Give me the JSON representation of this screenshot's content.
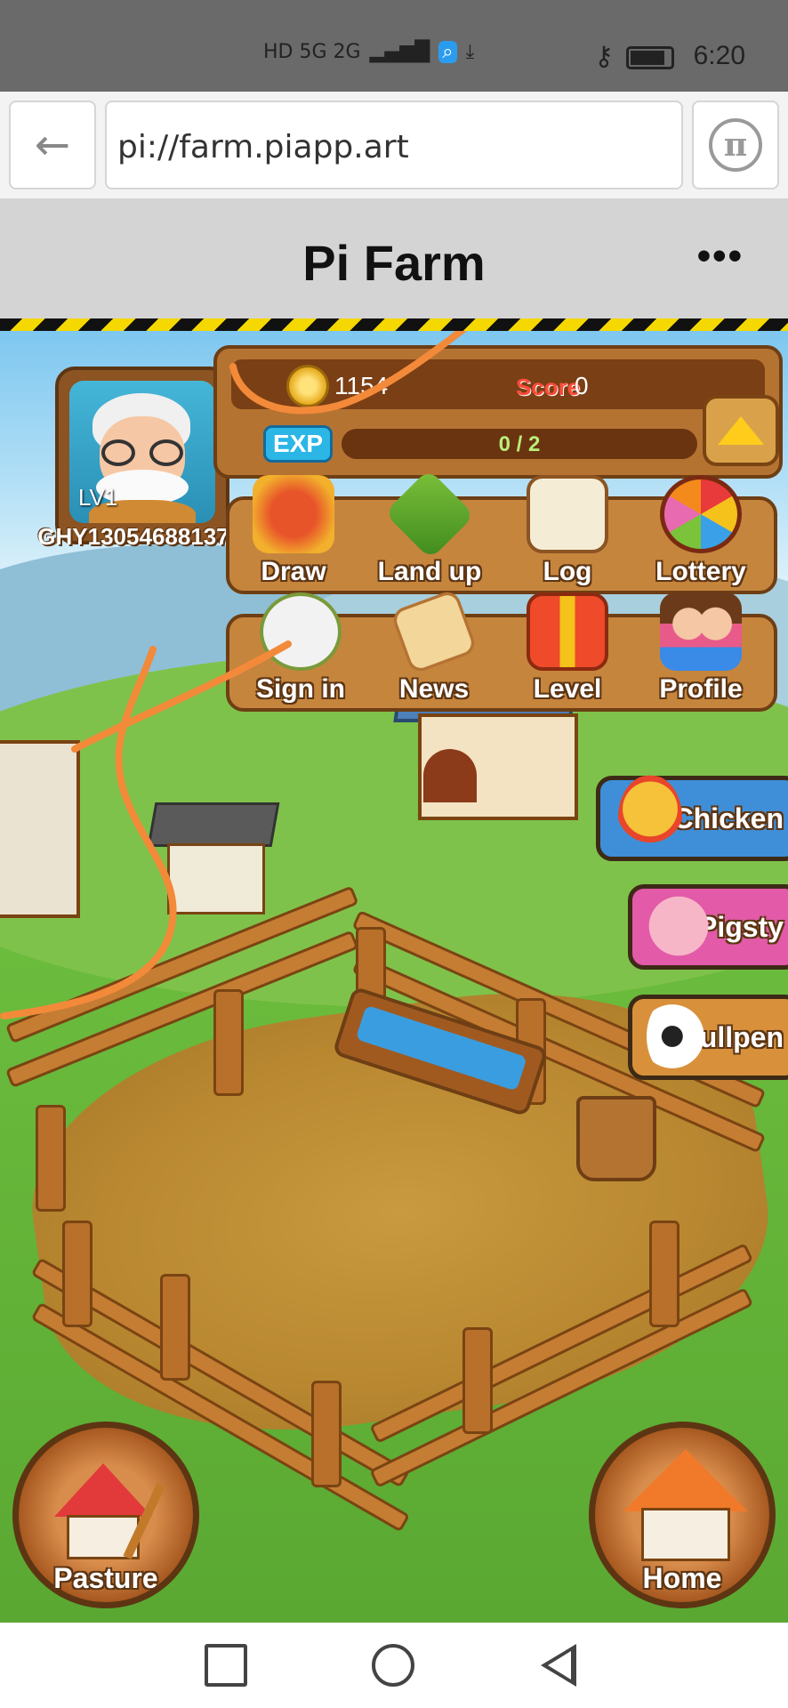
{
  "status_bar": {
    "network": "HD 5G 2G",
    "time": "6:20"
  },
  "browser": {
    "url": "pi://farm.piapp.art",
    "back_icon": "arrow-left-icon",
    "pi_icon": "pi-logo-icon"
  },
  "app": {
    "title": "Pi Farm",
    "more_label": "•••"
  },
  "player": {
    "level": "LV1",
    "name": "GHY13054688137",
    "coins": "1154",
    "score_label": "Score",
    "score": "0",
    "exp_label": "EXP",
    "exp": "0 / 2",
    "exp_fraction": 0
  },
  "menu": {
    "row1": [
      {
        "label": "Draw",
        "icon": "paint-bucket-icon"
      },
      {
        "label": "Land up",
        "icon": "land-up-icon"
      },
      {
        "label": "Log",
        "icon": "book-icon"
      },
      {
        "label": "Lottery",
        "icon": "lottery-wheel-icon"
      }
    ],
    "row2": [
      {
        "label": "Sign in",
        "icon": "sign-in-icon"
      },
      {
        "label": "News",
        "icon": "news-scroll-icon"
      },
      {
        "label": "Level",
        "icon": "gift-box-icon"
      },
      {
        "label": "Profile",
        "icon": "profile-kids-icon"
      }
    ]
  },
  "side_buttons": [
    {
      "label": "Chicken",
      "icon": "chicken-icon",
      "color": "#3f8fd8"
    },
    {
      "label": "Pigsty",
      "icon": "pig-icon",
      "color": "#e25aa8"
    },
    {
      "label": "Bullpen",
      "icon": "cow-icon",
      "color": "#d8913a"
    }
  ],
  "bottom_buttons": {
    "pasture": "Pasture",
    "home": "Home"
  },
  "colors": {
    "header_bg": "#d4d4d4",
    "wood": "#b57332",
    "wood_dark": "#6e3e14"
  }
}
